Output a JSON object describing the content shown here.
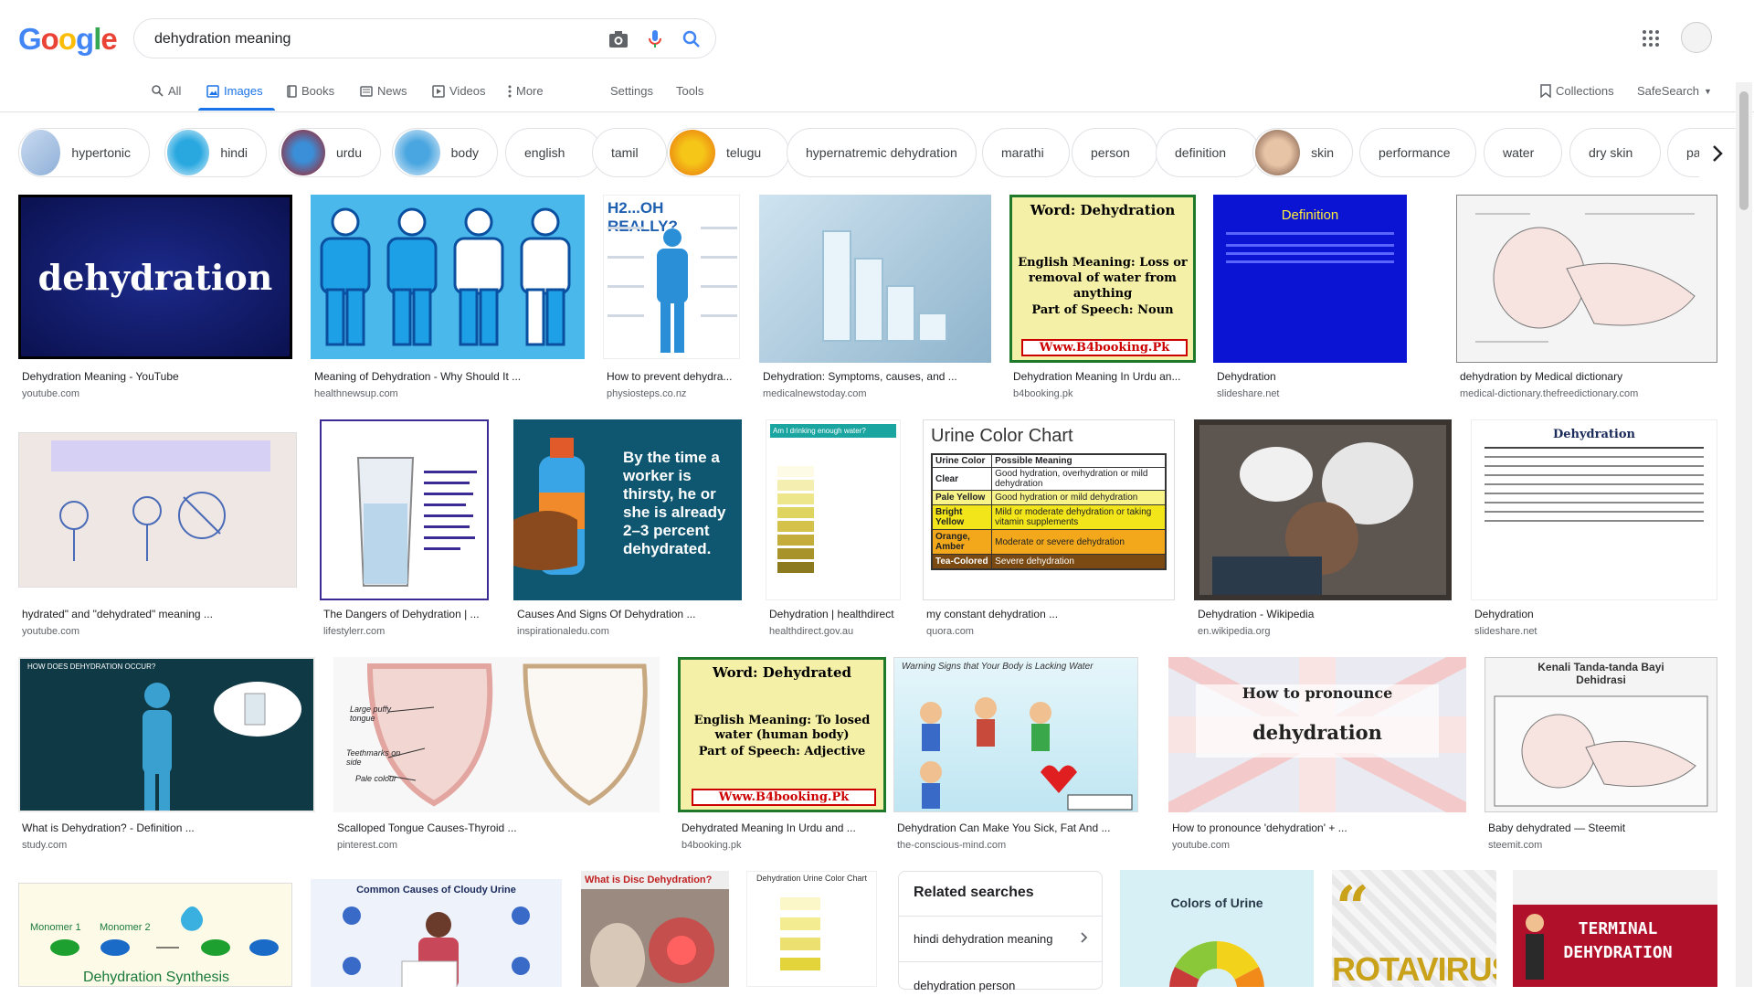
{
  "search": {
    "query": "dehydration meaning"
  },
  "nav": {
    "tabs": [
      {
        "label": "All"
      },
      {
        "label": "Images"
      },
      {
        "label": "Books"
      },
      {
        "label": "News"
      },
      {
        "label": "Videos"
      },
      {
        "label": "More"
      }
    ],
    "settings": "Settings",
    "tools": "Tools",
    "collections": "Collections",
    "safesearch": "SafeSearch"
  },
  "chips": [
    {
      "label": "hypertonic"
    },
    {
      "label": "hindi"
    },
    {
      "label": "urdu"
    },
    {
      "label": "body"
    },
    {
      "label": "english"
    },
    {
      "label": "tamil"
    },
    {
      "label": "telugu"
    },
    {
      "label": "hypernatremic dehydration"
    },
    {
      "label": "marathi"
    },
    {
      "label": "person"
    },
    {
      "label": "definition"
    },
    {
      "label": "skin"
    },
    {
      "label": "performance"
    },
    {
      "label": "water"
    },
    {
      "label": "dry skin"
    },
    {
      "label": "patient"
    }
  ],
  "results": [
    {
      "title": "Dehydration Meaning - YouTube",
      "source": "youtube.com",
      "img_text": "dehydration"
    },
    {
      "title": "Meaning of Dehydration - Why Should It ...",
      "source": "healthnewsup.com"
    },
    {
      "title": "How to prevent dehydra...",
      "source": "physiosteps.co.nz",
      "img_text": "H2...OH REALLY?"
    },
    {
      "title": "Dehydration: Symptoms, causes, and ...",
      "source": "medicalnewstoday.com"
    },
    {
      "title": "Dehydration Meaning In Urdu an...",
      "source": "b4booking.pk",
      "img_text": "Word: Dehydration",
      "img_text2": "English Meaning: Loss or removal of water from anything",
      "img_text3": "Part of Speech: Noun",
      "img_text4": "Www.B4booking.Pk"
    },
    {
      "title": "Dehydration",
      "source": "slideshare.net",
      "img_text": "Definition"
    },
    {
      "title": "dehydration by Medical dictionary",
      "source": "medical-dictionary.thefreedictionary.com"
    },
    {
      "title": "hydrated\" and \"dehydrated\" meaning ...",
      "source": "youtube.com"
    },
    {
      "title": "The Dangers of Dehydration | ...",
      "source": "lifestylerr.com"
    },
    {
      "title": "Causes And Signs Of Dehydration ...",
      "source": "inspirationaledu.com",
      "img_text": "By the time a worker is thirsty, he or she is already 2–3 percent dehydrated."
    },
    {
      "title": "Dehydration | healthdirect",
      "source": "healthdirect.gov.au",
      "img_text": "Am I drinking enough water?"
    },
    {
      "title": "my constant dehydration ...",
      "source": "quora.com",
      "img_text": "Urine Color Chart"
    },
    {
      "title": "Dehydration - Wikipedia",
      "source": "en.wikipedia.org"
    },
    {
      "title": "Dehydration",
      "source": "slideshare.net",
      "img_text": "Dehydration"
    },
    {
      "title": "What is Dehydration? - Definition ...",
      "source": "study.com",
      "img_text": "HOW DOES DEHYDRATION OCCUR?"
    },
    {
      "title": "Scalloped Tongue Causes-Thyroid ...",
      "source": "pinterest.com",
      "img_text": "Large puffy tongue",
      "img_text2": "Teethmarks on side",
      "img_text3": "Pale colour"
    },
    {
      "title": "Dehydrated Meaning In Urdu and ...",
      "source": "b4booking.pk",
      "img_text": "Word: Dehydrated",
      "img_text2": "English Meaning: To losed water (human body)",
      "img_text3": "Part of Speech: Adjective",
      "img_text4": "Www.B4booking.Pk"
    },
    {
      "title": "Dehydration Can Make You Sick, Fat And ...",
      "source": "the-conscious-mind.com",
      "img_text": "Warning Signs that Your Body is Lacking Water"
    },
    {
      "title": "How to pronounce 'dehydration' + ...",
      "source": "youtube.com",
      "img_text": "How to pronounce",
      "img_text2": "dehydration"
    },
    {
      "title": "Baby dehydrated — Steemit",
      "source": "steemit.com",
      "img_text": "Kenali Tanda-tanda Bayi Dehidrasi"
    },
    {
      "img_text": "Dehydration Synthesis",
      "img_text2": "Monomer 1",
      "img_text3": "Monomer 2"
    },
    {
      "img_text": "Common Causes of Cloudy Urine"
    },
    {
      "img_text": "What is Disc Dehydration?"
    },
    {
      "img_text": "Dehydration Urine Color Chart"
    },
    {
      "img_text": "Colors of Urine"
    },
    {
      "img_text": "ROTAVIRUS"
    },
    {
      "img_text": "TERMINAL DEHYDRATION"
    }
  ],
  "urine_chart": {
    "head1": "Urine Color",
    "head2": "Possible Meaning",
    "rows": [
      {
        "c": "Clear",
        "m": "Good hydration, overhydration or mild dehydration"
      },
      {
        "c": "Pale Yellow",
        "m": "Good hydration or mild dehydration"
      },
      {
        "c": "Bright Yellow",
        "m": "Mild or moderate dehydration or taking vitamin supplements"
      },
      {
        "c": "Orange, Amber",
        "m": "Moderate or severe dehydration"
      },
      {
        "c": "Tea-Colored",
        "m": "Severe dehydration"
      }
    ]
  },
  "related": {
    "title": "Related searches",
    "items": [
      {
        "label": "hindi dehydration meaning"
      },
      {
        "label": "dehydration person"
      }
    ]
  },
  "colors": {
    "accent": "#1a73e8",
    "navy": "#0b1150",
    "cyan": "#1ea0e6",
    "slide_blue": "#0a14d2"
  }
}
